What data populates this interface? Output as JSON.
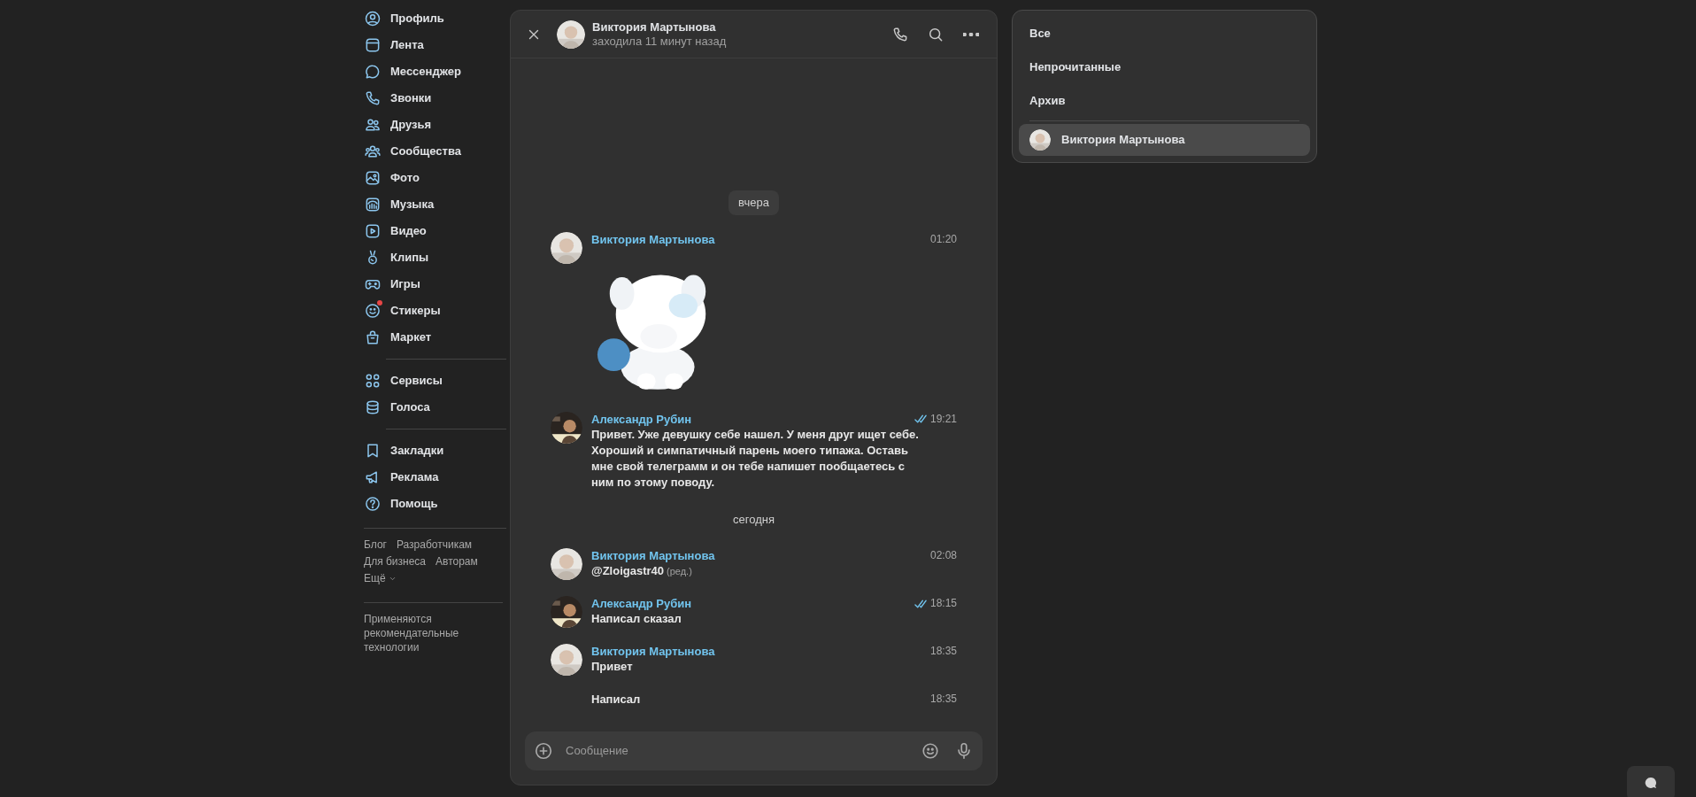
{
  "sidebar": {
    "sections": [
      {
        "items": [
          {
            "label": "Профиль"
          },
          {
            "label": "Лента"
          },
          {
            "label": "Мессенджер"
          },
          {
            "label": "Звонки"
          },
          {
            "label": "Друзья"
          },
          {
            "label": "Сообщества"
          },
          {
            "label": "Фото"
          },
          {
            "label": "Музыка"
          },
          {
            "label": "Видео"
          },
          {
            "label": "Клипы"
          },
          {
            "label": "Игры"
          },
          {
            "label": "Стикеры",
            "badge": true
          },
          {
            "label": "Маркет"
          }
        ]
      },
      {
        "items": [
          {
            "label": "Сервисы"
          },
          {
            "label": "Голоса"
          }
        ]
      },
      {
        "items": [
          {
            "label": "Закладки"
          },
          {
            "label": "Реклама"
          },
          {
            "label": "Помощь"
          }
        ]
      }
    ],
    "footer_links": [
      "Блог",
      "Разработчикам",
      "Для бизнеса",
      "Авторам",
      "Ещё"
    ],
    "note": "Применяются рекомендательные технологии"
  },
  "chat": {
    "header": {
      "name": "Виктория Мартынова",
      "status": "заходила 11 минут назад"
    },
    "messages": [
      {
        "kind": "date",
        "text": "вчера",
        "boxed": true
      },
      {
        "kind": "sticker",
        "author": "Виктория Мартынова",
        "time": "01:20"
      },
      {
        "kind": "text",
        "author": "Александр Рубин",
        "time": "19:21",
        "read": true,
        "text": "Привет. Уже девушку себе нашел. У меня друг ищет себе. Хороший и симпатичный парень моего типажа. Оставь мне свой телеграмм и он тебе напишет пообщаетесь с ним по этому поводу."
      },
      {
        "kind": "date",
        "text": "сегодня",
        "boxed": false
      },
      {
        "kind": "text",
        "author": "Виктория Мартынова",
        "time": "02:08",
        "text": "@Zloigastr40",
        "edited": "(ред.)"
      },
      {
        "kind": "text",
        "author": "Александр Рубин",
        "time": "18:15",
        "read": true,
        "text": "Написал сказал"
      },
      {
        "kind": "text",
        "author": "Виктория Мартынова",
        "time": "18:35",
        "text": "Привет"
      },
      {
        "kind": "text",
        "time": "18:35",
        "text": "Написал"
      }
    ],
    "composer": {
      "placeholder": "Сообщение"
    }
  },
  "folders": {
    "filters": [
      "Все",
      "Непрочитанные",
      "Архив"
    ],
    "chats": [
      {
        "name": "Виктория Мартынова",
        "selected": true
      }
    ]
  }
}
